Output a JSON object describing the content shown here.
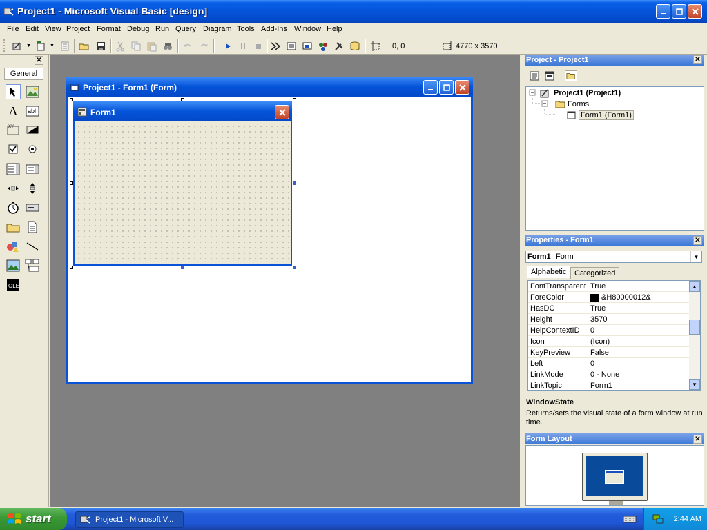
{
  "window": {
    "title": "Project1 - Microsoft Visual Basic [design]"
  },
  "menu": [
    "File",
    "Edit",
    "View",
    "Project",
    "Format",
    "Debug",
    "Run",
    "Query",
    "Diagram",
    "Tools",
    "Add-Ins",
    "Window",
    "Help"
  ],
  "toolbar": {
    "position": "0, 0",
    "size": "4770 x 3570"
  },
  "toolbox": {
    "tab_label": "General",
    "close_glyph": "✕"
  },
  "form_window": {
    "title": "Project1 - Form1 (Form)"
  },
  "form_designer": {
    "caption": "Form1"
  },
  "project_panel": {
    "title": "Project - Project1",
    "tree": [
      {
        "label": "Project1 (Project1)"
      },
      {
        "label": "Forms"
      },
      {
        "label": "Form1 (Form1)"
      }
    ]
  },
  "properties_panel": {
    "title": "Properties - Form1",
    "object_name": "Form1",
    "object_type": "Form",
    "tabs": [
      "Alphabetic",
      "Categorized"
    ],
    "rows": [
      {
        "name": "FontTransparent",
        "value": "True"
      },
      {
        "name": "ForeColor",
        "value": "&H80000012&"
      },
      {
        "name": "HasDC",
        "value": "True"
      },
      {
        "name": "Height",
        "value": "3570"
      },
      {
        "name": "HelpContextID",
        "value": "0"
      },
      {
        "name": "Icon",
        "value": "(Icon)"
      },
      {
        "name": "KeyPreview",
        "value": "False"
      },
      {
        "name": "Left",
        "value": "0"
      },
      {
        "name": "LinkMode",
        "value": "0 - None"
      },
      {
        "name": "LinkTopic",
        "value": "Form1"
      }
    ],
    "description_title": "WindowState",
    "description_text": "Returns/sets the visual state of a form window at run time."
  },
  "layout_panel": {
    "title": "Form Layout"
  },
  "taskbar": {
    "start_label": "start",
    "task_label": "Project1 - Microsoft V...",
    "clock": "2:44 AM"
  },
  "colors": {
    "xp_blue": "#0453D8",
    "start_green": "#3C9A37"
  }
}
